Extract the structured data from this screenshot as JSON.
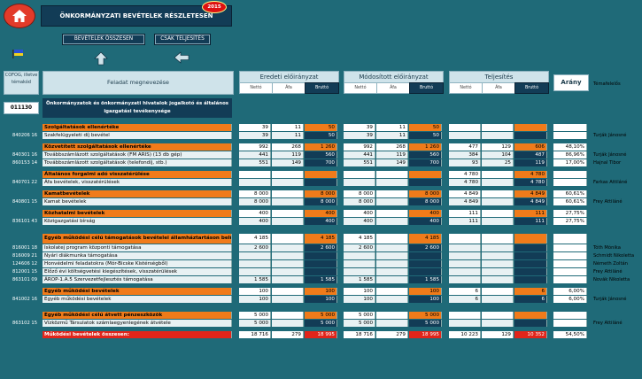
{
  "header": {
    "title": "ÖNKORMÁNYZATI BEVÉTELEK RÉSZLETESEN",
    "year_badge": "2015",
    "btn_summary": "BEVÉTELEK ÖSSZESEN",
    "btn_actual": "CSAK TELJESÍTÉS"
  },
  "columns": {
    "code": "COFOG, illetve témakód",
    "task": "Feladat megnevezése",
    "original": "Eredeti előirányzat",
    "modified": "Módosított előirányzat",
    "actual": "Teljesítés",
    "ratio": "Arány",
    "resp": "Témafelelős",
    "net": "Nettó",
    "vat": "Áfa",
    "gross": "Bruttó"
  },
  "section": {
    "code": "011130",
    "title": "Önkormányzatok és önkormányzati hivatalok jogalkotó és általános igazgatási tevékenysége"
  },
  "rows": [
    {
      "type": "group",
      "label": "Szolgáltatások ellenértéke",
      "on": "39",
      "oa": "11",
      "og": "50",
      "mn": "39",
      "ma": "11",
      "mg": "50",
      "an": "",
      "aa": "",
      "ag": "",
      "ratio": "",
      "code": "",
      "resp": ""
    },
    {
      "type": "item",
      "label": "Szakfelügyeleti díj bevétel",
      "on": "39",
      "oa": "11",
      "og": "50",
      "mn": "39",
      "ma": "11",
      "mg": "50",
      "an": "",
      "aa": "",
      "ag": "",
      "ratio": "",
      "code": "840206 16",
      "resp": "Turják Jánosné"
    },
    {
      "type": "gap"
    },
    {
      "type": "group",
      "label": "Közvetített szolgáltatások ellenértéke",
      "on": "992",
      "oa": "268",
      "og": "1 260",
      "mn": "992",
      "ma": "268",
      "mg": "1 260",
      "an": "477",
      "aa": "129",
      "ag": "606",
      "ratio": "48,10%",
      "code": "",
      "resp": ""
    },
    {
      "type": "item",
      "label": "Továbbszámlázott szolgáltatások (FM ARIS) (13 db gép)",
      "on": "441",
      "oa": "119",
      "og": "560",
      "mn": "441",
      "ma": "119",
      "mg": "560",
      "an": "384",
      "aa": "104",
      "ag": "487",
      "ratio": "86,96%",
      "code": "840301 16",
      "resp": "Turják Jánosné"
    },
    {
      "type": "item",
      "label": "Továbbszámlázott szolgáltatások (telefondíj, stb.)",
      "on": "551",
      "oa": "149",
      "og": "700",
      "mn": "551",
      "ma": "149",
      "mg": "700",
      "an": "93",
      "aa": "25",
      "ag": "119",
      "ratio": "17,00%",
      "code": "860153 14",
      "resp": "Hajnal Tibor"
    },
    {
      "type": "gap"
    },
    {
      "type": "group",
      "label": "Általános forgalmi adó visszatérülése",
      "on": "",
      "oa": "",
      "og": "",
      "mn": "",
      "ma": "",
      "mg": "",
      "an": "4 780",
      "aa": "",
      "ag": "4 780",
      "ratio": "",
      "code": "",
      "resp": ""
    },
    {
      "type": "item",
      "label": "Áfa bevételek, visszatérülések",
      "on": "",
      "oa": "",
      "og": "",
      "mn": "",
      "ma": "",
      "mg": "",
      "an": "4 780",
      "aa": "",
      "ag": "4 780",
      "ratio": "",
      "code": "840701 22",
      "resp": "Farkas Attiláné"
    },
    {
      "type": "gap"
    },
    {
      "type": "group",
      "label": "Kamatbevételek",
      "on": "8 000",
      "oa": "",
      "og": "8 000",
      "mn": "8 000",
      "ma": "",
      "mg": "8 000",
      "an": "4 849",
      "aa": "",
      "ag": "4 849",
      "ratio": "60,61%",
      "code": "",
      "resp": ""
    },
    {
      "type": "item",
      "label": "Kamat bevételek",
      "on": "8 000",
      "oa": "",
      "og": "8 000",
      "mn": "8 000",
      "ma": "",
      "mg": "8 000",
      "an": "4 849",
      "aa": "",
      "ag": "4 849",
      "ratio": "60,61%",
      "code": "840801 15",
      "resp": "Frey Attiláné"
    },
    {
      "type": "gap"
    },
    {
      "type": "group",
      "label": "Közhatalmi bevételek",
      "on": "400",
      "oa": "",
      "og": "400",
      "mn": "400",
      "ma": "",
      "mg": "400",
      "an": "111",
      "aa": "",
      "ag": "111",
      "ratio": "27,75%",
      "code": "",
      "resp": ""
    },
    {
      "type": "item",
      "label": "Közigazgatási bírság",
      "on": "400",
      "oa": "",
      "og": "400",
      "mn": "400",
      "ma": "",
      "mg": "400",
      "an": "111",
      "aa": "",
      "ag": "111",
      "ratio": "27,75%",
      "code": "836101 43",
      "resp": ""
    },
    {
      "type": "gap2"
    },
    {
      "type": "group2",
      "label": "Egyéb működési célú támogatások bevételei államháztartáson belülről",
      "on": "4 185",
      "oa": "",
      "og": "4 185",
      "mn": "4 185",
      "ma": "",
      "mg": "4 185",
      "an": "",
      "aa": "",
      "ag": "",
      "ratio": "",
      "code": "",
      "resp": ""
    },
    {
      "type": "item",
      "label": "Iskolatej program központi támogatása",
      "on": "2 600",
      "oa": "",
      "og": "2 600",
      "mn": "2 600",
      "ma": "",
      "mg": "2 600",
      "an": "",
      "aa": "",
      "ag": "",
      "ratio": "",
      "code": "816001 18",
      "resp": "Tóth Mónika"
    },
    {
      "type": "item",
      "label": "Nyári diákmunka támogatása",
      "on": "",
      "oa": "",
      "og": "",
      "mn": "",
      "ma": "",
      "mg": "",
      "an": "",
      "aa": "",
      "ag": "",
      "ratio": "",
      "code": "816009 21",
      "resp": "Schmidt Nikoletta"
    },
    {
      "type": "item",
      "label": "Honvédelmi feladatokra (Mór-Bicske Kistérségből)",
      "on": "",
      "oa": "",
      "og": "",
      "mn": "",
      "ma": "",
      "mg": "",
      "an": "",
      "aa": "",
      "ag": "",
      "ratio": "",
      "code": "124606 12",
      "resp": "Németh Zoltán"
    },
    {
      "type": "item",
      "label": "Előző évi költségvetési kiegészítések, visszatérülések",
      "on": "",
      "oa": "",
      "og": "",
      "mn": "",
      "ma": "",
      "mg": "",
      "an": "",
      "aa": "",
      "ag": "",
      "ratio": "",
      "code": "812001 15",
      "resp": "Frey Attiláné"
    },
    {
      "type": "item",
      "label": "ÁROP-1.A.5 Szervezetfejlesztés támogatása",
      "on": "1 585",
      "oa": "",
      "og": "1 585",
      "mn": "1 585",
      "ma": "",
      "mg": "1 585",
      "an": "",
      "aa": "",
      "ag": "",
      "ratio": "",
      "code": "863101 09",
      "resp": "Novák Nikoletta"
    },
    {
      "type": "gap"
    },
    {
      "type": "group",
      "label": "Egyéb működési bevételek",
      "on": "100",
      "oa": "",
      "og": "100",
      "mn": "100",
      "ma": "",
      "mg": "100",
      "an": "6",
      "aa": "",
      "ag": "6",
      "ratio": "6,00%",
      "code": "",
      "resp": ""
    },
    {
      "type": "item",
      "label": "Egyéb működési bevételek",
      "on": "100",
      "oa": "",
      "og": "100",
      "mn": "100",
      "ma": "",
      "mg": "100",
      "an": "6",
      "aa": "",
      "ag": "6",
      "ratio": "6,00%",
      "code": "841002 16",
      "resp": "Turják Jánosné"
    },
    {
      "type": "gap2"
    },
    {
      "type": "group",
      "label": "Egyéb működési célú átvett pénzeszközök",
      "on": "5 000",
      "oa": "",
      "og": "5 000",
      "mn": "5 000",
      "ma": "",
      "mg": "5 000",
      "an": "",
      "aa": "",
      "ag": "",
      "ratio": "",
      "code": "",
      "resp": ""
    },
    {
      "type": "item",
      "label": "Vízközmű Társulatok számlaegyenlegének átvétele",
      "on": "5 000",
      "oa": "",
      "og": "5 000",
      "mn": "5 000",
      "ma": "",
      "mg": "5 000",
      "an": "",
      "aa": "",
      "ag": "",
      "ratio": "",
      "code": "863102 15",
      "resp": "Frey Attiláné"
    },
    {
      "type": "gap"
    },
    {
      "type": "total",
      "label": "Működési bevételek összesen:",
      "on": "18 716",
      "oa": "279",
      "og": "18 995",
      "mn": "18 716",
      "ma": "279",
      "mg": "18 995",
      "an": "10 223",
      "aa": "129",
      "ag": "10 352",
      "ratio": "54,50%",
      "code": "",
      "resp": ""
    }
  ]
}
